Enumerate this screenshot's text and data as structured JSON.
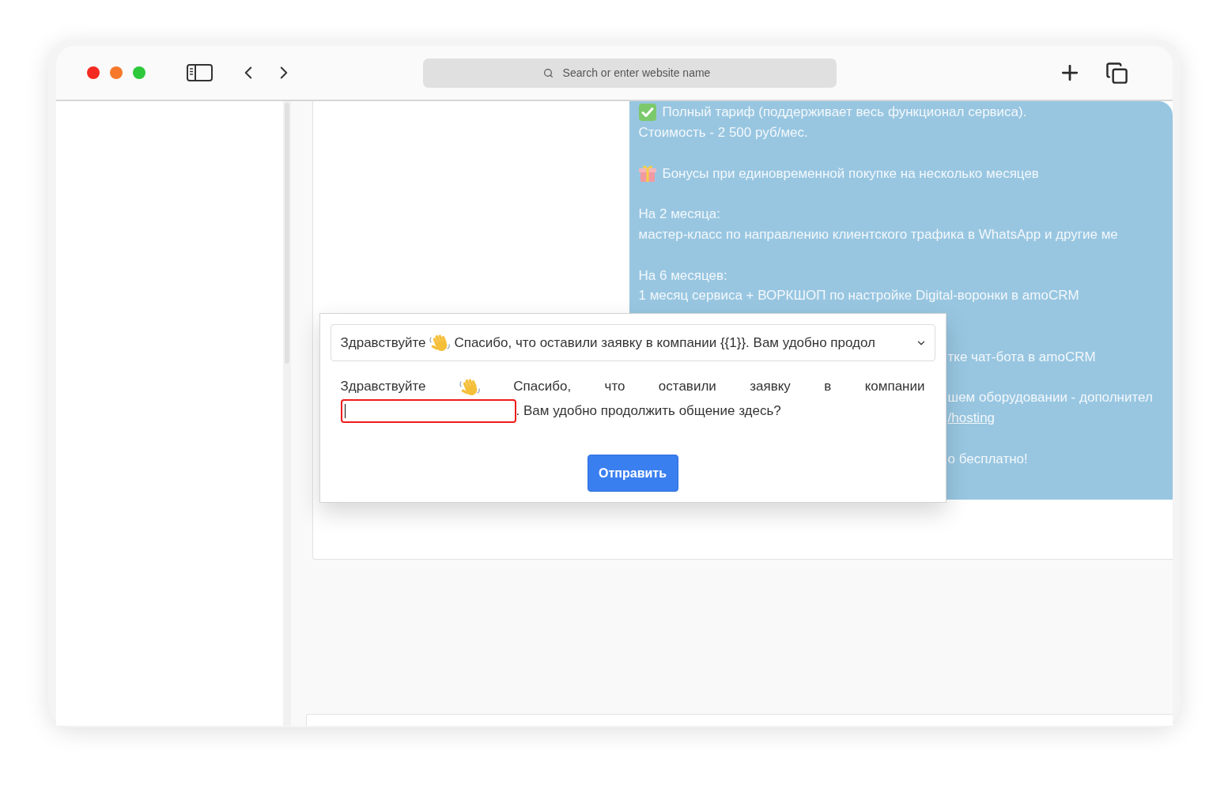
{
  "browser": {
    "address_bar": {
      "placeholder": "Search or enter website name"
    }
  },
  "message": {
    "lines": [
      {
        "kind": "check",
        "text": "Полный тариф (поддерживает весь функционал сервиса).",
        "covered": false
      },
      {
        "kind": "plain",
        "text": "Стоимость - 2 500 руб/мес.",
        "covered": false
      },
      {
        "kind": "blank"
      },
      {
        "kind": "gift",
        "text": "Бонусы при единовременной покупке на несколько месяцев",
        "covered": false
      },
      {
        "kind": "blank"
      },
      {
        "kind": "plain",
        "text": "На 2 месяца:",
        "covered": false
      },
      {
        "kind": "plain",
        "text": "мастер-класс по направлению клиентского трафика в WhatsApp и другие ме",
        "covered": false
      },
      {
        "kind": "blank"
      },
      {
        "kind": "plain",
        "text": "На 6 месяцев:",
        "covered": false
      },
      {
        "kind": "plain",
        "text": "1 месяц сервиса + ВОРКШОП по настройке Digital-воронки в amoCRM",
        "covered": false
      },
      {
        "kind": "blank"
      },
      {
        "kind": "blank"
      },
      {
        "kind": "plain",
        "text": "тке чат-бота в amoCRM",
        "covered": true
      },
      {
        "kind": "blank"
      },
      {
        "kind": "plain",
        "text": "шем оборудовании - дополнител",
        "covered": true
      },
      {
        "kind": "link",
        "text": "/hosting",
        "covered": true
      },
      {
        "kind": "blank"
      },
      {
        "kind": "plain",
        "text": "о бесплатно!",
        "covered": true
      }
    ]
  },
  "dialog": {
    "select": {
      "greeting": "Здравствуйте",
      "text": "Спасибо, что оставили заявку в компании {{1}}. Вам удобно продол"
    },
    "preview": {
      "greeting": "Здравствуйте",
      "before_field": "Спасибо, что оставили заявку в компании",
      "field": {
        "error": true,
        "focused": true
      },
      "after_field": ". Вам удобно продолжить общение здесь?"
    },
    "submit_button": "Отправить"
  }
}
